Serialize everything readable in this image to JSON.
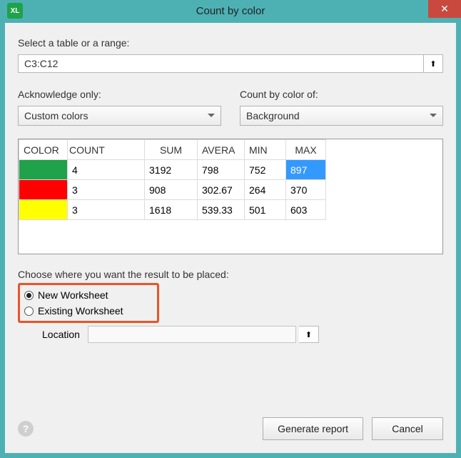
{
  "title": "Count by color",
  "app_icon_text": "XL",
  "close_glyph": "✕",
  "labels": {
    "select_range": "Select a table or a range:",
    "ack_only": "Acknowledge only:",
    "count_by": "Count by color of:",
    "choose_where": "Choose where you want the result to be placed:",
    "location": "Location"
  },
  "range_value": "C3:C12",
  "ack_only_value": "Custom colors",
  "count_by_value": "Background",
  "table": {
    "headers": [
      "COLOR",
      "COUNT",
      "SUM",
      "AVERA",
      "MIN",
      "MAX"
    ],
    "rows": [
      {
        "color": "#1fa249",
        "count": "4",
        "sum": "3192",
        "avg": "798",
        "min": "752",
        "max": "897",
        "max_selected": true
      },
      {
        "color": "#ff0000",
        "count": "3",
        "sum": "908",
        "avg": "302.67",
        "min": "264",
        "max": "370",
        "max_selected": false
      },
      {
        "color": "#ffff00",
        "count": "3",
        "sum": "1618",
        "avg": "539.33",
        "min": "501",
        "max": "603",
        "max_selected": false
      }
    ]
  },
  "radios": {
    "new_ws": "New Worksheet",
    "existing_ws": "Existing Worksheet",
    "selected": "new_ws"
  },
  "buttons": {
    "generate": "Generate report",
    "cancel": "Cancel"
  },
  "help_glyph": "?",
  "ref_arrow": "⬆"
}
